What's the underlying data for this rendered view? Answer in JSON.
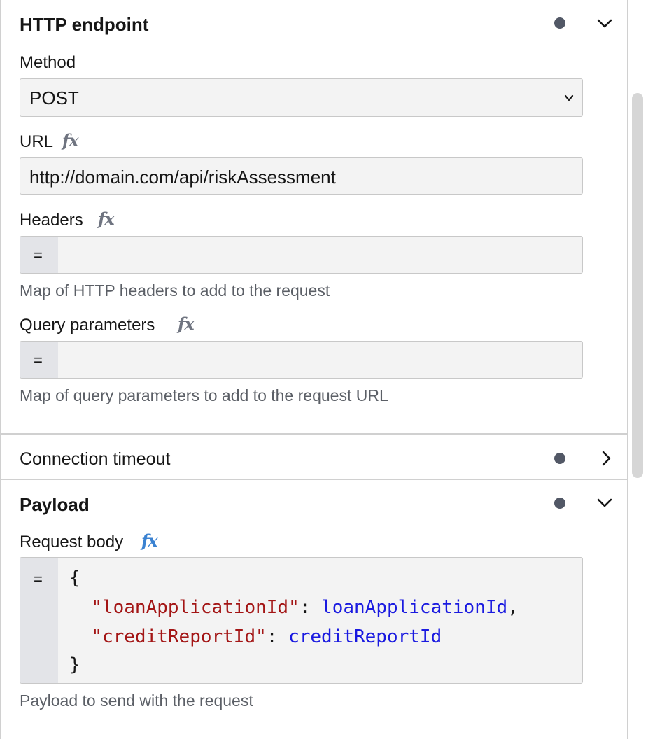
{
  "sections": {
    "http_endpoint": {
      "title": "HTTP endpoint",
      "method": {
        "label": "Method",
        "value": "POST"
      },
      "url": {
        "label": "URL",
        "fx": "fx",
        "value": "http://domain.com/api/riskAssessment"
      },
      "headers": {
        "label": "Headers",
        "fx": "fx",
        "prefix": "=",
        "value": "",
        "helper": "Map of HTTP headers to add to the request"
      },
      "query": {
        "label": "Query parameters",
        "fx": "fx",
        "prefix": "=",
        "value": "",
        "helper": "Map of query parameters to add to the request URL"
      }
    },
    "connection_timeout": {
      "title": "Connection timeout"
    },
    "payload": {
      "title": "Payload",
      "request_body": {
        "label": "Request body",
        "fx": "fx",
        "prefix": "=",
        "code": {
          "open": "{",
          "line1_key": "\"loanApplicationId\"",
          "line1_sep": ": ",
          "line1_val": "loanApplicationId",
          "line1_end": ",",
          "line2_key": "\"creditReportId\"",
          "line2_sep": ": ",
          "line2_val": "creditReportId",
          "close": "}"
        },
        "helper": "Payload to send with the request"
      }
    }
  },
  "colors": {
    "status_dot": "#525866",
    "fx_inactive": "#6f7480",
    "fx_active": "#3b82d1",
    "string_literal": "#a31515",
    "identifier": "#1a1ae0"
  },
  "icons": [
    "status-dot",
    "chevron-down-icon",
    "chevron-right-icon",
    "fx-icon",
    "select-arrow-icon"
  ]
}
